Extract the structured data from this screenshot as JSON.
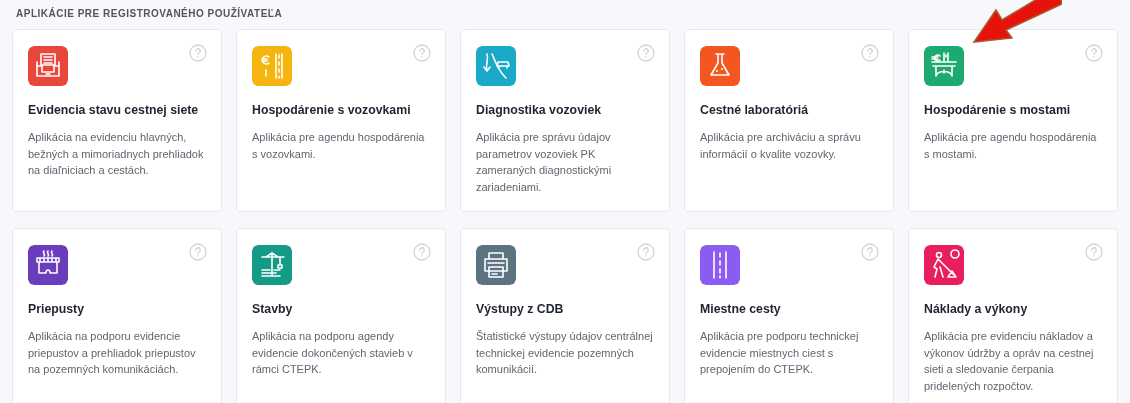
{
  "heading": "APLIKÁCIE PRE REGISTROVANÉHO POUŽÍVATEĽA",
  "apps": [
    {
      "title": "Evidencia stavu cestnej siete",
      "description": "Aplikácia na evidenciu hlavných, bežných a mimoriadnych prehliadok na diaľniciach a cestách.",
      "color": "#e8473b"
    },
    {
      "title": "Hospodárenie s vozovkami",
      "description": "Aplikácia pre agendu hospodárenia s vozovkami.",
      "color": "#f6b40e"
    },
    {
      "title": "Diagnostika vozoviek",
      "description": "Aplikácia pre správu údajov parametrov vozoviek PK zameraných diagnostickými zariadeniami.",
      "color": "#1ba9c9"
    },
    {
      "title": "Cestné laboratóriá",
      "description": "Aplikácia pre archiváciu a správu informácií o kvalite vozovky.",
      "color": "#f4561f"
    },
    {
      "title": "Hospodárenie s mostami",
      "description": "Aplikácia pre agendu hospodárenia s mostami.",
      "color": "#1caa6e"
    },
    {
      "title": "Priepusty",
      "description": "Aplikácia na podporu evidencie priepustov a prehliadok priepustov na pozemných komunikáciách.",
      "color": "#6a3dbd"
    },
    {
      "title": "Stavby",
      "description": "Aplikácia na podporu agendy evidencie dokončených stavieb v rámci CTEPK.",
      "color": "#149b86"
    },
    {
      "title": "Výstupy z CDB",
      "description": "Štatistické výstupy údajov centrálnej technickej evidencie pozemných komunikácií.",
      "color": "#5c7482"
    },
    {
      "title": "Miestne cesty",
      "description": "Aplikácia pre podporu technickej evidencie miestnych ciest s prepojením do CTEPK.",
      "color": "#8b5cf1"
    },
    {
      "title": "Náklady a výkony",
      "description": "Aplikácia pre evidenciu nákladov a výkonov údržby a opráv na cestnej sieti a sledovanie čerpania pridelených rozpočtov.",
      "color": "#e91e5e"
    }
  ]
}
